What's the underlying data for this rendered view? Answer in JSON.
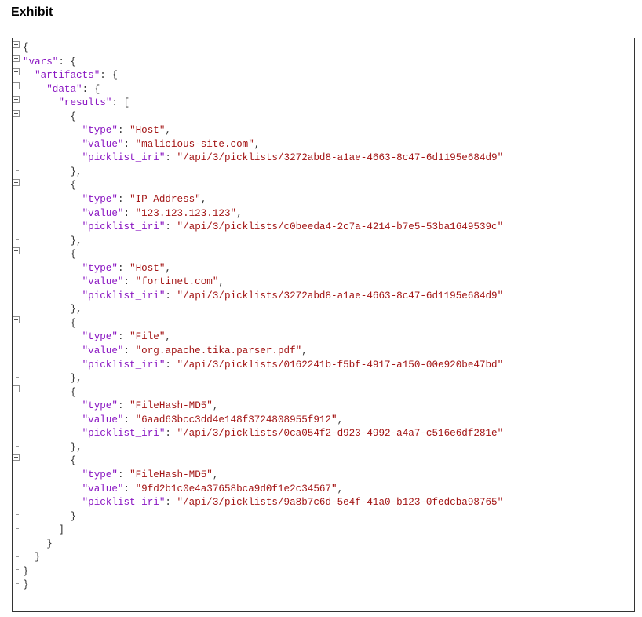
{
  "heading": "Exhibit",
  "json_viewer": {
    "keys": {
      "vars": "\"vars\"",
      "artifacts": "\"artifacts\"",
      "data": "\"data\"",
      "results": "\"results\"",
      "type": "\"type\"",
      "value": "\"value\"",
      "picklist_iri": "\"picklist_iri\""
    },
    "results": [
      {
        "type": "\"Host\"",
        "value": "\"malicious-site.com\"",
        "picklist_iri": "\"/api/3/picklists/3272abd8-a1ae-4663-8c47-6d1195e684d9\""
      },
      {
        "type": "\"IP Address\"",
        "value": "\"123.123.123.123\"",
        "picklist_iri": "\"/api/3/picklists/c0beeda4-2c7a-4214-b7e5-53ba1649539c\""
      },
      {
        "type": "\"Host\"",
        "value": "\"fortinet.com\"",
        "picklist_iri": "\"/api/3/picklists/3272abd8-a1ae-4663-8c47-6d1195e684d9\""
      },
      {
        "type": "\"File\"",
        "value": "\"org.apache.tika.parser.pdf\"",
        "picklist_iri": "\"/api/3/picklists/0162241b-f5bf-4917-a150-00e920be47bd\""
      },
      {
        "type": "\"FileHash-MD5\"",
        "value": "\"6aad63bcc3dd4e148f3724808955f912\"",
        "picklist_iri": "\"/api/3/picklists/0ca054f2-d923-4992-a4a7-c516e6df281e\""
      },
      {
        "type": "\"FileHash-MD5\"",
        "value": "\"9fd2b1c0e4a37658bca9d0f1e2c34567\"",
        "picklist_iri": "\"/api/3/picklists/9a8b7c6d-5e4f-41a0-b123-0fedcba98765\""
      }
    ]
  }
}
